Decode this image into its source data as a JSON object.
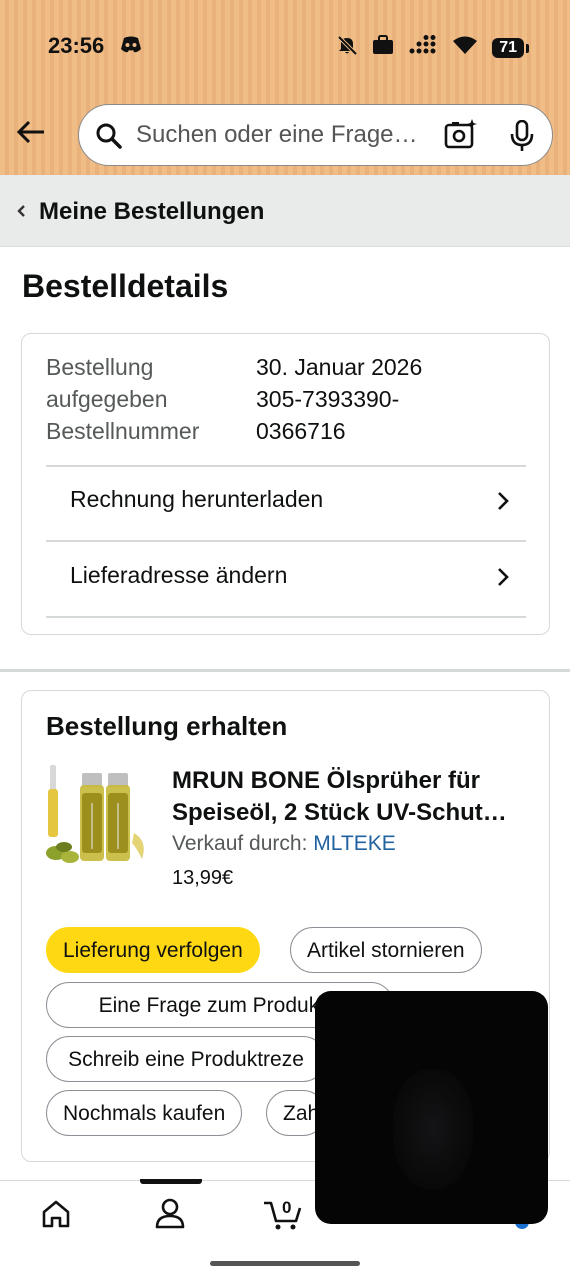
{
  "status_bar": {
    "time": "23:56",
    "battery": "71"
  },
  "search": {
    "placeholder": "Suchen oder eine Frage…"
  },
  "breadcrumb": {
    "label": "Meine Bestellungen"
  },
  "page_title": "Bestelldetails",
  "order_info": {
    "rows": [
      {
        "label": "Bestellung",
        "value": "30. Januar 2026"
      },
      {
        "label": "aufgegeben",
        "value": "305-7393390-"
      },
      {
        "label": "Bestellnummer",
        "value": "0366716"
      }
    ],
    "links": [
      {
        "label": "Rechnung herunterladen"
      },
      {
        "label": "Lieferadresse ändern"
      }
    ]
  },
  "shipment": {
    "status": "Bestellung erhalten",
    "product": {
      "name": "MRUN BONE Ölsprüher für Speiseöl, 2 Stück UV-Schut…",
      "seller_prefix": "Verkauf durch:",
      "seller": "MLTEKE",
      "price": "13,99€"
    },
    "buttons": [
      "Lieferung verfolgen",
      "Artikel stornieren",
      "Eine Frage zum Produkt s",
      "Schreib eine Produktreze",
      "Nochmals kaufen",
      "Zah"
    ]
  },
  "bottom_nav": {
    "cart_count": "0"
  },
  "colors": {
    "accent_yellow": "#ffd814",
    "link_blue": "#2162a1",
    "header_orange": "#f0bd86"
  }
}
